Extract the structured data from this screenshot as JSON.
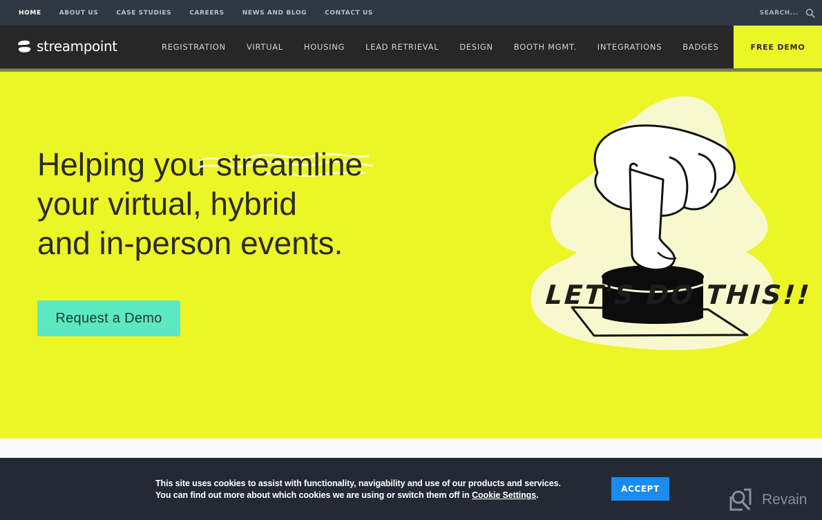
{
  "topbar": {
    "links": [
      {
        "label": "HOME",
        "active": true
      },
      {
        "label": "ABOUT US"
      },
      {
        "label": "CASE STUDIES"
      },
      {
        "label": "CAREERS"
      },
      {
        "label": "NEWS AND BLOG"
      },
      {
        "label": "CONTACT US"
      }
    ],
    "search": {
      "placeholder": "SEARCH...",
      "icon": "search-icon"
    }
  },
  "nav": {
    "brand": "streampoint",
    "links": [
      {
        "label": "REGISTRATION"
      },
      {
        "label": "VIRTUAL"
      },
      {
        "label": "HOUSING"
      },
      {
        "label": "LEAD RETRIEVAL"
      },
      {
        "label": "DESIGN"
      },
      {
        "label": "BOOTH MGMT."
      },
      {
        "label": "INTEGRATIONS"
      },
      {
        "label": "BADGES"
      }
    ],
    "cta": "FREE DEMO"
  },
  "hero": {
    "headline_before": "Helping you",
    "headline_highlight": "streamline",
    "headline_line2": "your virtual, hybrid",
    "headline_line3": "and in-person events.",
    "cta": "Request a Demo",
    "tagline": "LET'S DO THIS!!",
    "illustration": "hand-pressing-button-illustration"
  },
  "cookie": {
    "line1": "This site uses cookies to assist with functionality, navigability and use of our products and services.",
    "line2_before": "You can find out more about which cookies we are using or switch them off in ",
    "link": "Cookie Settings",
    "line2_after": ".",
    "accept": "ACCEPT"
  },
  "watermark": {
    "label": "Revain",
    "icon": "revain-logo-icon"
  },
  "colors": {
    "accent_yellow": "#ecf525",
    "cta_teal": "#5ce8c0",
    "topbar_bg": "#2f3742",
    "nav_bg": "#272727",
    "cookie_bg": "#232a35",
    "accept_blue": "#1a8cf0"
  }
}
